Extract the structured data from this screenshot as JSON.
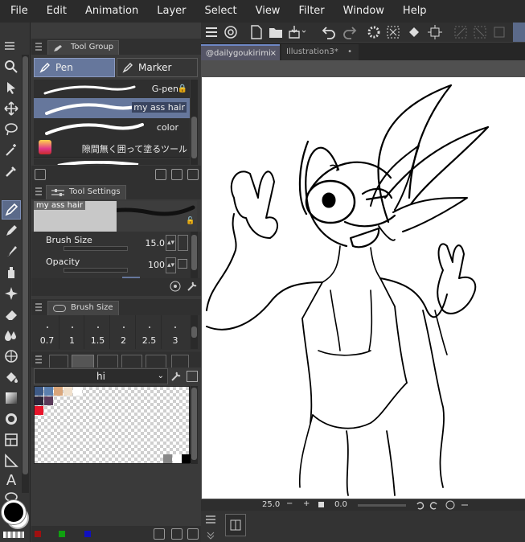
{
  "menu": [
    "File",
    "Edit",
    "Animation",
    "Layer",
    "Select",
    "View",
    "Filter",
    "Window",
    "Help"
  ],
  "tool_group": {
    "title": "Tool Group",
    "tabs": [
      "Pen",
      "Marker"
    ],
    "brushes": [
      {
        "label": "G-pen",
        "locked": true
      },
      {
        "label": "my ass hair",
        "selected": true
      },
      {
        "label": "color"
      },
      {
        "label": "隙間無く囲って塗るツール"
      }
    ]
  },
  "tool_settings": {
    "title": "Tool Settings",
    "preview_label": "my ass hair",
    "brush_size_label": "Brush Size",
    "brush_size_value": "15.0",
    "opacity_label": "Opacity",
    "opacity_value": "100"
  },
  "brush_size_panel": {
    "title": "Brush Size",
    "sizes": [
      "0.7",
      "1",
      "1.5",
      "2",
      "2.5",
      "3"
    ]
  },
  "color_set": {
    "selected_set": "hi",
    "swatches": [
      "#3e5a86",
      "#5b7fae",
      "#d9a57a",
      "#f0e0cc",
      "#ffffff",
      "#2b2538",
      "#5a3a5a",
      "#d51a5a",
      "#e8142a"
    ]
  },
  "document_tabs": [
    {
      "label": "@dailygoukirimi",
      "active": true,
      "close": "×"
    },
    {
      "label": "Illustration3*",
      "active": false,
      "close": "•"
    }
  ],
  "status": {
    "zoom": "25.0",
    "rotation": "0.0",
    "minus": "−",
    "plus": "+"
  },
  "colors": {
    "main": "#000000",
    "sub": "#ffffff",
    "accent": "#66779c"
  }
}
